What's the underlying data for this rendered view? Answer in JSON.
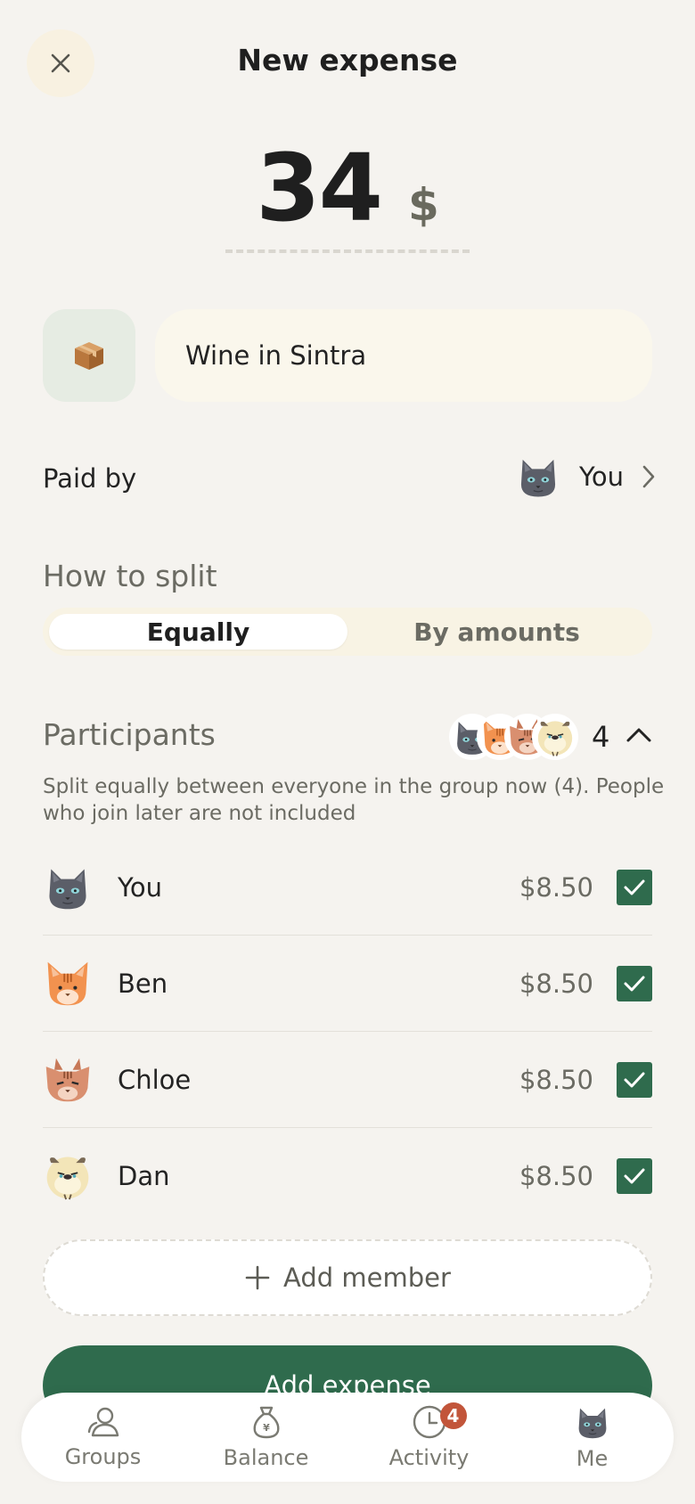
{
  "header": {
    "title": "New expense"
  },
  "amount": {
    "value": "34",
    "currency": "$"
  },
  "expense": {
    "category_icon": "package-icon",
    "description": "Wine in Sintra"
  },
  "paid_by": {
    "label": "Paid by",
    "payer": "You"
  },
  "split": {
    "heading": "How to split",
    "options": [
      "Equally",
      "By amounts"
    ],
    "selected": "Equally"
  },
  "participants": {
    "heading": "Participants",
    "count": "4",
    "note": "Split equally between everyone in the group now (4). People who join later are not included",
    "members": [
      {
        "name": "You",
        "amount": "$8.50",
        "checked": true,
        "avatar": "gray-cat-icon"
      },
      {
        "name": "Ben",
        "amount": "$8.50",
        "checked": true,
        "avatar": "orange-cat-icon"
      },
      {
        "name": "Chloe",
        "amount": "$8.50",
        "checked": true,
        "avatar": "tabby-cat-icon"
      },
      {
        "name": "Dan",
        "amount": "$8.50",
        "checked": true,
        "avatar": "cream-cat-icon"
      }
    ]
  },
  "actions": {
    "add_member": "Add member",
    "add_expense": "Add expense"
  },
  "nav": {
    "items": [
      {
        "label": "Groups",
        "icon": "groups-icon"
      },
      {
        "label": "Balance",
        "icon": "money-bag-icon"
      },
      {
        "label": "Activity",
        "icon": "clock-icon",
        "badge": "4"
      },
      {
        "label": "Me",
        "icon": "gray-cat-icon"
      }
    ]
  },
  "colors": {
    "accent": "#2f6b4d",
    "badge": "#c2553a",
    "background": "#f5f3ef"
  }
}
